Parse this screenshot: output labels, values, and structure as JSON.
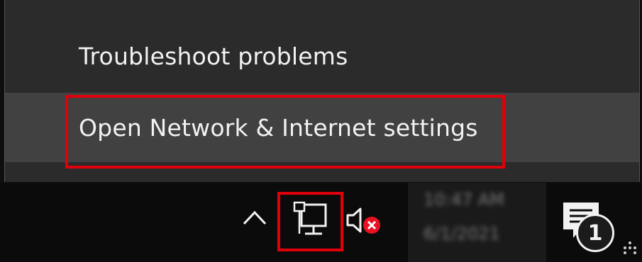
{
  "menu": {
    "items": [
      {
        "label": "Troubleshoot problems"
      },
      {
        "label": "Open Network & Internet settings"
      }
    ]
  },
  "taskbar": {
    "clock": {
      "time": "10:47 AM",
      "date": "6/1/2021"
    },
    "notifications": {
      "badge_count": "1"
    },
    "icons": [
      "chevron-up-icon",
      "network-icon",
      "speaker-muted-icon",
      "notifications-icon"
    ]
  },
  "colors": {
    "menu_bg": "#2b2b2b",
    "menu_hover": "#414141",
    "highlight": "#e0000b",
    "taskbar_bg": "#0b0b0b",
    "text": "#f2f2f2"
  }
}
